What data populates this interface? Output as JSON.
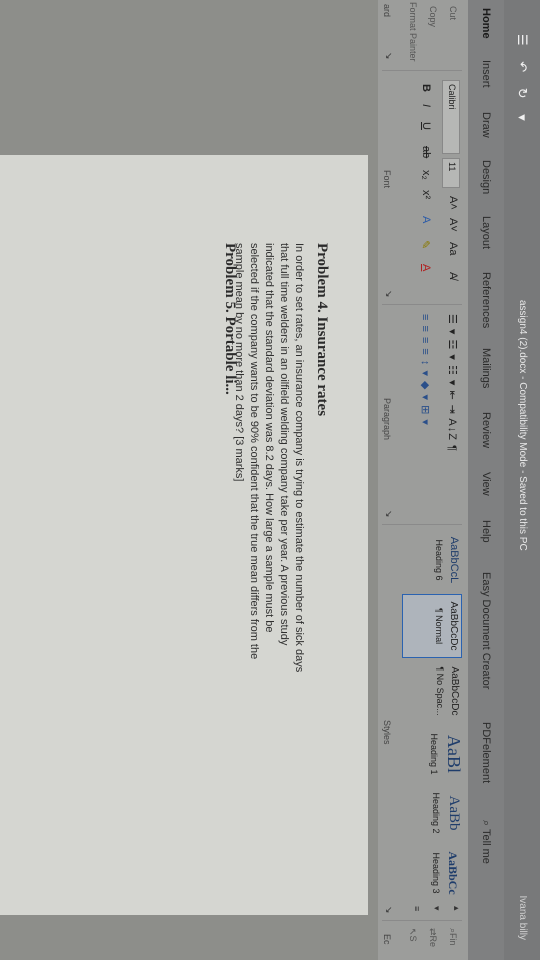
{
  "titlebar": {
    "quick_access": "☰ ↶ ↻ ▾",
    "doc_title": "assign4 (2).docx  -  Compatibility Mode  -  Saved to this PC",
    "user": "Ivana billy"
  },
  "tabs": [
    {
      "label": "Home"
    },
    {
      "label": "Insert"
    },
    {
      "label": "Draw"
    },
    {
      "label": "Design"
    },
    {
      "label": "Layout"
    },
    {
      "label": "References"
    },
    {
      "label": "Mailings"
    },
    {
      "label": "Review"
    },
    {
      "label": "View"
    },
    {
      "label": "Help"
    },
    {
      "label": "Easy Document Creator"
    },
    {
      "label": "PDFelement"
    },
    {
      "label": "Tell me"
    }
  ],
  "clipboard": {
    "cut": "Cut",
    "copy": "Copy",
    "format_painter": "Format Painter",
    "label": "ard"
  },
  "font": {
    "name": "Calibri",
    "size": "11",
    "grow": "A˄",
    "shrink": "A˅",
    "case": "Aa",
    "clear": "A̸",
    "bold": "B",
    "italic": "I",
    "underline": "U",
    "strike": "ab",
    "subscript": "x₂",
    "superscript": "x²",
    "effects": "A",
    "highlight": "✎",
    "color": "A",
    "label": "Font"
  },
  "paragraph": {
    "row1": "☰ ▾  ☲ ▾  ☷ ▾   ⇤ ⇥   A↓Z  ¶",
    "row2": "≡ ≡ ≡ ≡   ↕ ▾   ◆ ▾   ⊞ ▾",
    "label": "Paragraph"
  },
  "styles": {
    "items": [
      {
        "preview": "AaBbCcL",
        "name": "Heading 6"
      },
      {
        "preview": "AaBbCcDc",
        "name": "¶ Normal"
      },
      {
        "preview": "AaBbCcDc",
        "name": "¶ No Spac..."
      },
      {
        "preview": "AaBl",
        "name": "Heading 1"
      },
      {
        "preview": "AaBb",
        "name": "Heading 2"
      },
      {
        "preview": "AaBbCc",
        "name": "Heading 3"
      }
    ],
    "label": "Styles"
  },
  "editing": {
    "find": "Fin",
    "replace": "Re",
    "select": "S",
    "label": "Ec"
  },
  "document": {
    "problem_title": "Problem 4. Insurance rates",
    "problem_body": "In order to set rates, an insurance company is trying to estimate the number of sick days that full time welders in an oilfield welding company take per year. A previous study indicated that the standard deviation was 8.2 days. How large a sample must be selected if the company wants to be 90% confident that the true mean differs from the sample mean by no more than 2 days? [3 marks]",
    "next_title": "Problem 5. Portable li..."
  }
}
